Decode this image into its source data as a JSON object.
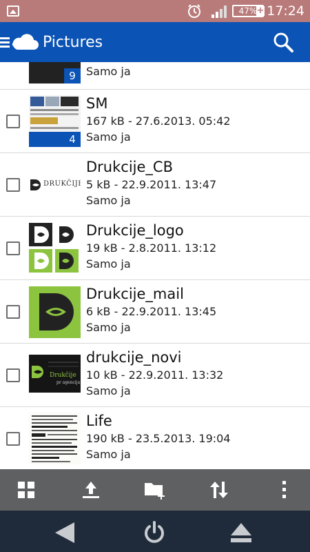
{
  "status_bar": {
    "time": "17:24",
    "battery": "47%",
    "battery_charging": "+"
  },
  "app_bar": {
    "title": "Pictures"
  },
  "files": [
    {
      "name": "",
      "meta": "",
      "share": "Samo ja",
      "badge": "9"
    },
    {
      "name": "SM",
      "meta": "167 kB - 27.6.2013. 05:42",
      "share": "Samo ja",
      "badge": "4"
    },
    {
      "name": "Drukcije_CB",
      "meta": "5 kB - 22.9.2011. 13:47",
      "share": "Samo ja",
      "thumb_text": "DRUKČIJE"
    },
    {
      "name": "Drukcije_logo",
      "meta": "19 kB - 2.8.2011. 13:12",
      "share": "Samo ja"
    },
    {
      "name": "Drukcije_mail",
      "meta": "6 kB - 22.9.2011. 13:45",
      "share": "Samo ja"
    },
    {
      "name": "drukcije_novi",
      "meta": "10 kB - 22.9.2011. 13:32",
      "share": "Samo ja",
      "thumb_text": "Drukčije",
      "thumb_subtext": "pr agencija"
    },
    {
      "name": "Life",
      "meta": "190 kB - 23.5.2013. 19:04",
      "share": "Samo ja"
    }
  ],
  "toolbar": {
    "icons": [
      "grid-icon",
      "upload-icon",
      "new-folder-icon",
      "sort-icon",
      "more-icon"
    ]
  },
  "navbar": {
    "icons": [
      "back-icon",
      "power-icon",
      "eject-icon"
    ]
  },
  "colors": {
    "status_bar": "#b97a7a",
    "app_bar": "#0b53b5",
    "toolbar": "#5f6062",
    "navbar": "#1f2b3b",
    "accent_green": "#8cc43f"
  }
}
